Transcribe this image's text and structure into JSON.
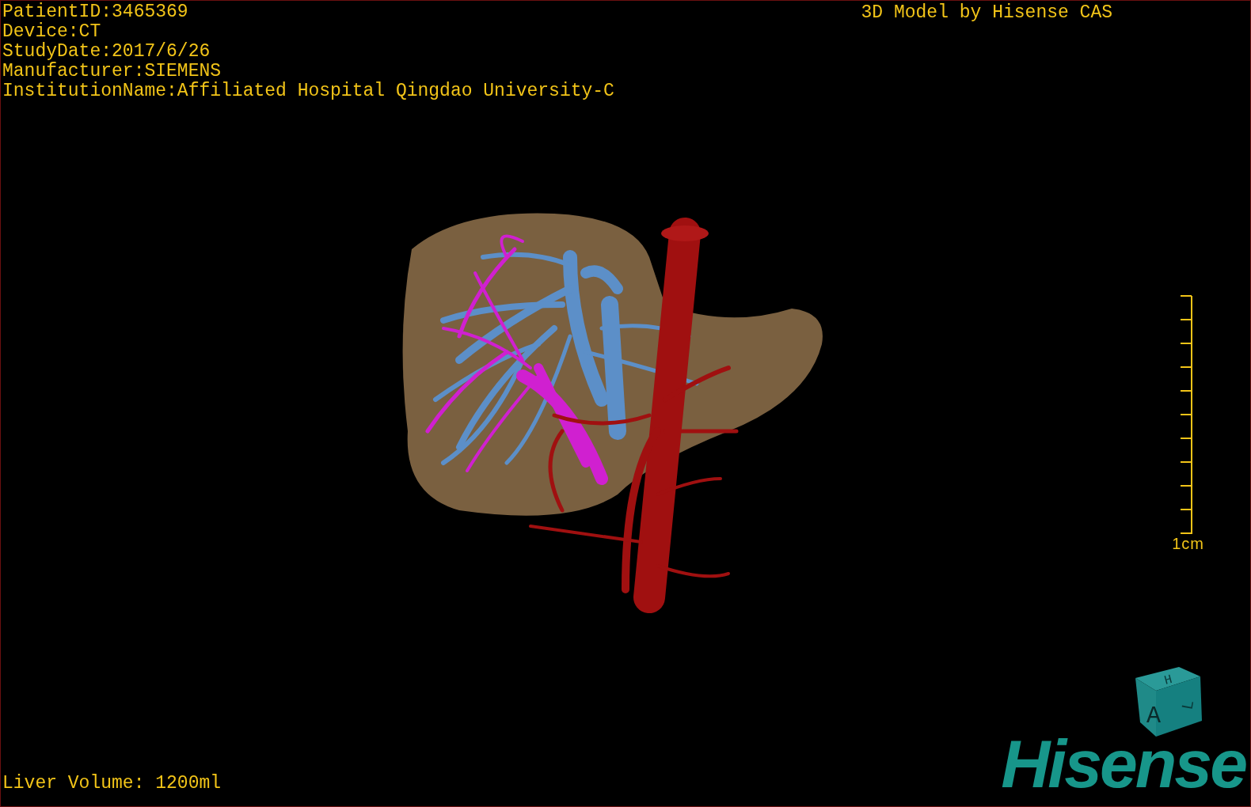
{
  "patient_info": [
    "PatientID:3465369",
    "Device:CT",
    "StudyDate:2017/6/26",
    "Manufacturer:SIEMENS",
    "InstitutionName:Affiliated Hospital Qingdao University-C"
  ],
  "model_caption": "3D Model by Hisense CAS",
  "scale_bar": {
    "label": "1cm"
  },
  "orientation_cube": {
    "top": "H",
    "front": "A",
    "side": "L"
  },
  "liver_volume": "Liver Volume: 1200ml",
  "logo": "Hisense"
}
